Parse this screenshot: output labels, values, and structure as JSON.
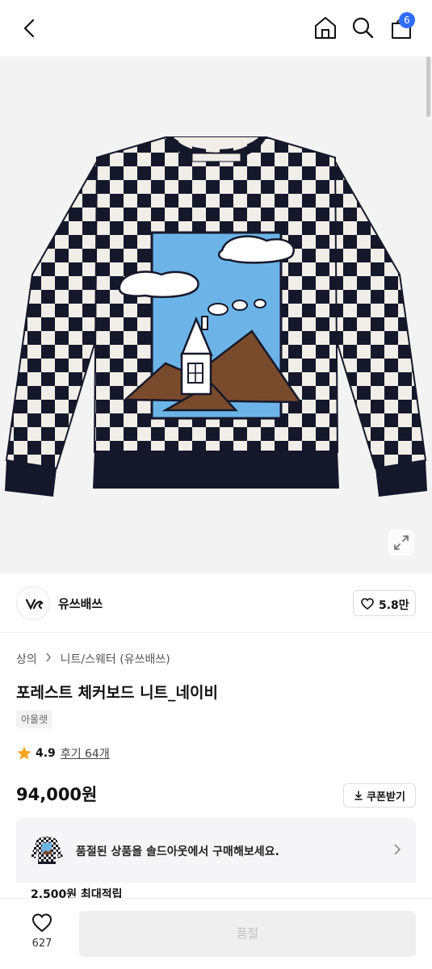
{
  "header": {
    "cart_count": "6",
    "icons": [
      "back-icon",
      "home-icon",
      "search-icon",
      "shopping-bag-icon"
    ]
  },
  "brand": {
    "name": "유쓰배쓰",
    "like_count": "5.8만"
  },
  "breadcrumb": {
    "category": "상의",
    "subcategory": "니트/스웨터 (유쓰배쓰)"
  },
  "product": {
    "title": "포레스트 체커보드 니트_네이비",
    "tag": "아울렛",
    "rating": "4.9",
    "reviews": "후기 64개",
    "price": "94,000원",
    "coupon_label": "쿠폰받기"
  },
  "soldout": {
    "message": "품절된 상품을 솔드아웃에서 구매해보세요."
  },
  "points": {
    "text": "2,500원 최대적립"
  },
  "bottom": {
    "wish_count": "627",
    "buy_label": "품절"
  },
  "colors": {
    "accent": "#2f6cf6",
    "star": "#f5a623",
    "navy": "#1a1f3a",
    "sky": "#6cb4e8",
    "mountain": "#7a4a2c"
  }
}
